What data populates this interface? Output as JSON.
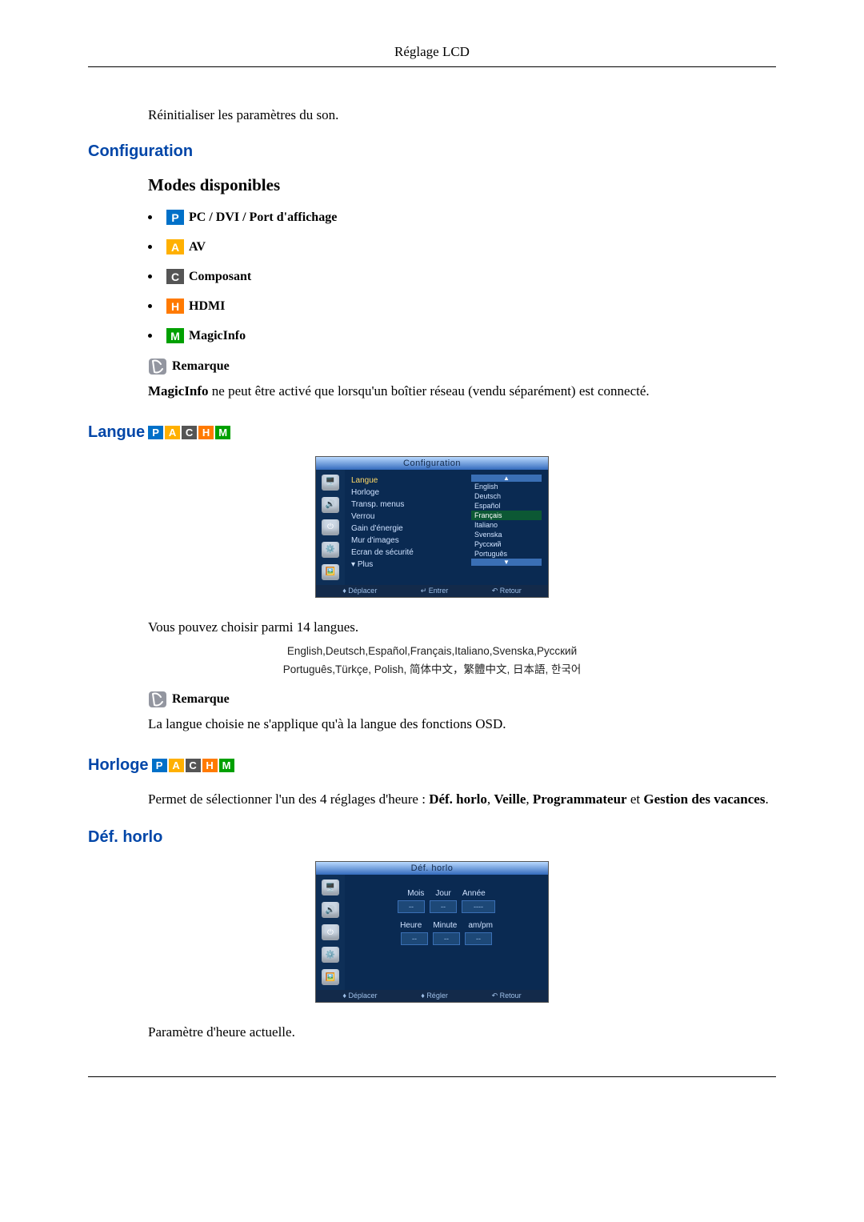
{
  "header": "Réglage LCD",
  "reset_text": "Réinitialiser les paramètres du son.",
  "configuration": {
    "title": "Configuration",
    "modes_title": "Modes disponibles",
    "modes": [
      {
        "badge": "P",
        "cls": "mb-p",
        "label": "PC / DVI / Port d'affichage"
      },
      {
        "badge": "A",
        "cls": "mb-a",
        "label": "AV"
      },
      {
        "badge": "C",
        "cls": "mb-c",
        "label": "Composant"
      },
      {
        "badge": "H",
        "cls": "mb-h",
        "label": "HDMI"
      },
      {
        "badge": "M",
        "cls": "mb-m",
        "label": "MagicInfo"
      }
    ],
    "note_label": "Remarque",
    "note_text_bold": "MagicInfo",
    "note_text_rest": " ne peut être activé que lorsqu'un boîtier réseau (vendu séparément) est connecté."
  },
  "langue": {
    "title": "Langue",
    "osd_title": "Configuration",
    "menu_items": [
      "Langue",
      "Horloge",
      "Transp. menus",
      "Verrou",
      "Gain d'énergie",
      "Mur d'images",
      "Ecran de sécurité",
      "Plus"
    ],
    "lang_options": [
      "English",
      "Deutsch",
      "Español",
      "Français",
      "Italiano",
      "Svenska",
      "Русский",
      "Português"
    ],
    "selected": "Français",
    "footer": [
      "Déplacer",
      "Entrer",
      "Retour"
    ],
    "desc": "Vous pouvez choisir parmi 14 langues.",
    "lang_line1": "English,Deutsch,Español,Français,Italiano,Svenska,Русский",
    "lang_line2": "Português,Türkçe, Polish, 简体中文，繁體中文, 日本語, 한국어",
    "note_label": "Remarque",
    "note_text": "La langue choisie ne s'applique qu'à la langue des fonctions OSD."
  },
  "horloge": {
    "title": "Horloge",
    "intro_pre": "Permet de sélectionner l'un des 4 réglages d'heure : ",
    "b1": "Déf. horlo",
    "s1": ", ",
    "b2": "Veille",
    "s2": ", ",
    "b3": "Programmateur",
    "s3": " et ",
    "b4": "Gestion des vacances",
    "s4": "."
  },
  "defhorlo": {
    "title": "Déf. horlo",
    "osd_title": "Déf. horlo",
    "row1_labels": [
      "Mois",
      "Jour",
      "Année"
    ],
    "row2_labels": [
      "Heure",
      "Minute",
      "am/pm"
    ],
    "dash": "--",
    "dash_wide": "----",
    "footer": [
      "Déplacer",
      "Régler",
      "Retour"
    ],
    "desc": "Paramètre d'heure actuelle."
  }
}
